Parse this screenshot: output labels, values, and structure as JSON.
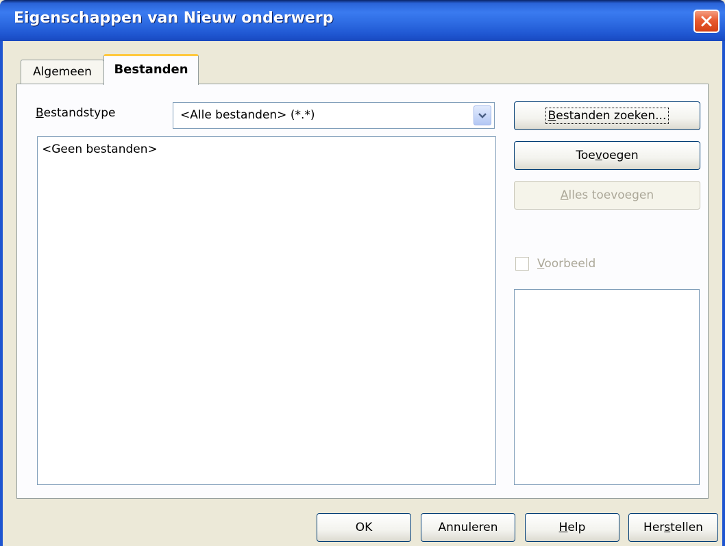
{
  "window": {
    "title": "Eigenschappen van Nieuw onderwerp"
  },
  "tabs": [
    {
      "label": "Algemeen",
      "active": false
    },
    {
      "label": "Bestanden",
      "active": true
    }
  ],
  "filetype": {
    "label_mnemonic": "B",
    "label_rest": "estandstype",
    "selected": "<Alle bestanden> (*.*)"
  },
  "file_list": {
    "empty_text": "<Geen bestanden>"
  },
  "buttons": {
    "search": {
      "mnemonic": "B",
      "rest": "estanden zoeken..."
    },
    "add": {
      "pre": "Toe",
      "mnemonic": "v",
      "post": "oegen"
    },
    "add_all": {
      "mnemonic": "A",
      "rest": "lles toevoegen",
      "enabled": false
    }
  },
  "preview": {
    "mnemonic": "V",
    "rest": "oorbeeld",
    "checked": false,
    "enabled": false
  },
  "footer": {
    "ok": "OK",
    "cancel": "Annuleren",
    "help": {
      "mnemonic": "H",
      "rest": "elp"
    },
    "reset": {
      "pre": "Her",
      "mnemonic": "s",
      "post": "tellen"
    }
  },
  "icons": {
    "close": "close-icon",
    "dropdown": "chevron-down-icon"
  },
  "colors": {
    "titlebar": "#2b68e0",
    "close_button": "#e85c32",
    "active_tab_accent": "#ffc83c",
    "dialog_background": "#ece9d8",
    "disabled_text": "#aca899"
  }
}
